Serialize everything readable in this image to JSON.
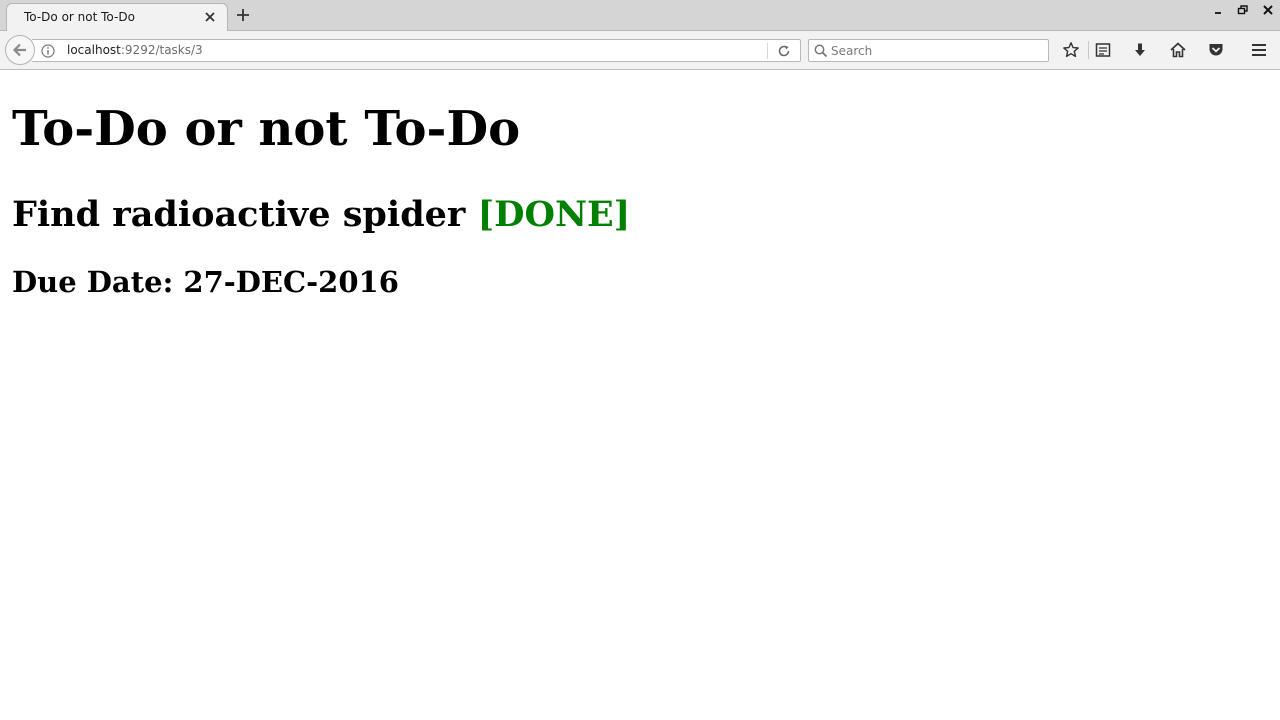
{
  "browser": {
    "tab": {
      "title": "To-Do or not To-Do"
    },
    "url": {
      "host": "localhost",
      "rest": ":9292/tasks/3"
    },
    "search": {
      "placeholder": "Search"
    }
  },
  "page": {
    "title": "To-Do or not To-Do",
    "task": {
      "name": "Find radioactive spider",
      "status": "[DONE]",
      "status_color": "#008000"
    },
    "due_date_label": "Due Date:",
    "due_date": "27-DEC-2016"
  }
}
